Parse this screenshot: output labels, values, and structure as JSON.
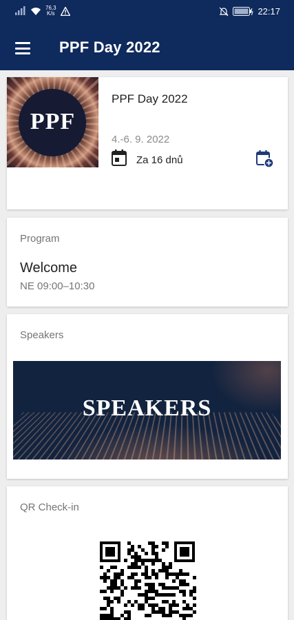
{
  "status_bar": {
    "speed_value": "76,3",
    "speed_unit": "K/s",
    "time": "22:17",
    "icons": [
      "signal-icon",
      "wifi-icon",
      "warning-icon",
      "mute-icon",
      "battery-icon"
    ]
  },
  "app_bar": {
    "title": "PPF Day 2022",
    "menu_icon": "hamburger-menu-icon"
  },
  "event": {
    "logo_text": "PPF",
    "title": "PPF Day 2022",
    "date": "4.-6. 9. 2022",
    "countdown": "Za 16 dnů",
    "add_to_calendar_icon": "calendar-add-icon"
  },
  "program": {
    "label": "Program",
    "session_title": "Welcome",
    "session_time": "NE 09:00–10:30"
  },
  "speakers": {
    "label": "Speakers",
    "banner_text": "SPEAKERS"
  },
  "qr_checkin": {
    "label": "QR Check-in"
  },
  "colors": {
    "primary": "#0f2a5c",
    "accent_icon": "#1f3a7a",
    "background": "#eeeeee"
  }
}
